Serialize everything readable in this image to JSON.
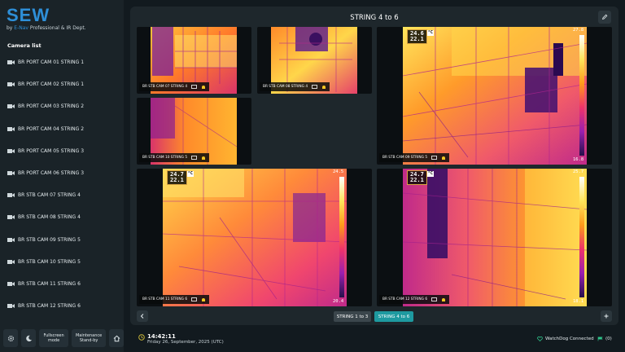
{
  "brand": {
    "logo": "SEW",
    "tagline_by": "by ",
    "tagline_brand": "E-Nav",
    "tagline_rest": " Professional & IR Dept."
  },
  "sidebar": {
    "title": "Camera list",
    "items": [
      {
        "label": "BR PORT CAM 01 STRING 1"
      },
      {
        "label": "BR PORT CAM 02 STRING 1"
      },
      {
        "label": "BR PORT CAM 03 STRING 2"
      },
      {
        "label": "BR PORT CAM 04 STRING 2"
      },
      {
        "label": "BR PORT CAM 05 STRING 3"
      },
      {
        "label": "BR PORT CAM 06 STRING 3"
      },
      {
        "label": "BR STB CAM 07 STRING 4"
      },
      {
        "label": "BR STB CAM 08 STRING 4"
      },
      {
        "label": "BR STB CAM 09 STRING 5"
      },
      {
        "label": "BR STB CAM 10 STRING 5"
      },
      {
        "label": "BR STB CAM 11 STRING 6"
      },
      {
        "label": "BR STB CAM 12 STRING 6"
      }
    ],
    "bottom": {
      "settings_icon": "gear-icon",
      "night_icon": "moon-icon",
      "fullscreen_label": "Fullscreen mode",
      "maintenance_label": "Maintenance Stand-by",
      "home_icon": "home-icon"
    }
  },
  "main": {
    "title": "STRING 4 to 6",
    "tiles": [
      {
        "label": "BR STB CAM 07 STRING 4"
      },
      {
        "label": "BR STB CAM 08 STRING 4"
      },
      {
        "label": "BR STB CAM 10 STRING 5"
      },
      {
        "label": "BR STB CAM 09 STRING 5",
        "max": "24.6",
        "min": "22.1",
        "unit": "°C",
        "scale_top": "27.8",
        "scale_bottom": "16.8"
      },
      {
        "label": "BR STB CAM 11 STRING 6",
        "max": "24.7",
        "min": "22.1",
        "unit": "°C",
        "scale_top": "24.5",
        "scale_bottom": "20.4"
      },
      {
        "label": "BR STB CAM 12 STRING 6",
        "max": "24.7",
        "min": "22.1",
        "unit": "°C",
        "scale_top": "25.7",
        "scale_bottom": "18.1"
      }
    ],
    "pager": {
      "tab_a": "STRING 1 to 3",
      "tab_b": "STRING 4 to 6"
    }
  },
  "footer": {
    "time": "14:42:11",
    "date": "Friday 26, September, 2025 (UTC)",
    "watchdog": "WatchDog Connected",
    "flag_count": "(0)"
  },
  "colors": {
    "accent": "#1e9aa0",
    "brand": "#2e8fd8",
    "thermal_hot": "#ffe55c",
    "thermal_mid": "#ff5a3c",
    "thermal_cool": "#b0248f"
  }
}
